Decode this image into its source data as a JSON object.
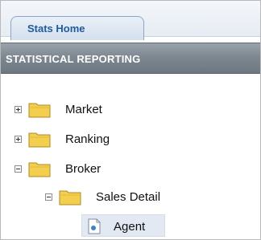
{
  "tabs": [
    {
      "label": "Stats Home",
      "active": true
    }
  ],
  "section": {
    "title": "STATISTICAL REPORTING"
  },
  "tree": {
    "market": {
      "label": "Market",
      "expanded": false
    },
    "ranking": {
      "label": "Ranking",
      "expanded": false
    },
    "broker": {
      "label": "Broker",
      "expanded": true
    },
    "sales_detail": {
      "label": "Sales Detail",
      "expanded": true
    },
    "agent": {
      "label": "Agent",
      "selected": true
    }
  },
  "icons": {
    "toggle_collapsed": "plus-box-icon",
    "toggle_expanded": "minus-box-icon",
    "folder": "folder-icon",
    "report": "report-page-icon"
  },
  "colors": {
    "tab_text": "#1f5b9c",
    "header_bg": "#7e8891",
    "folder_fill": "#f2cf4e",
    "selected_bg": "#e2e9f3"
  }
}
